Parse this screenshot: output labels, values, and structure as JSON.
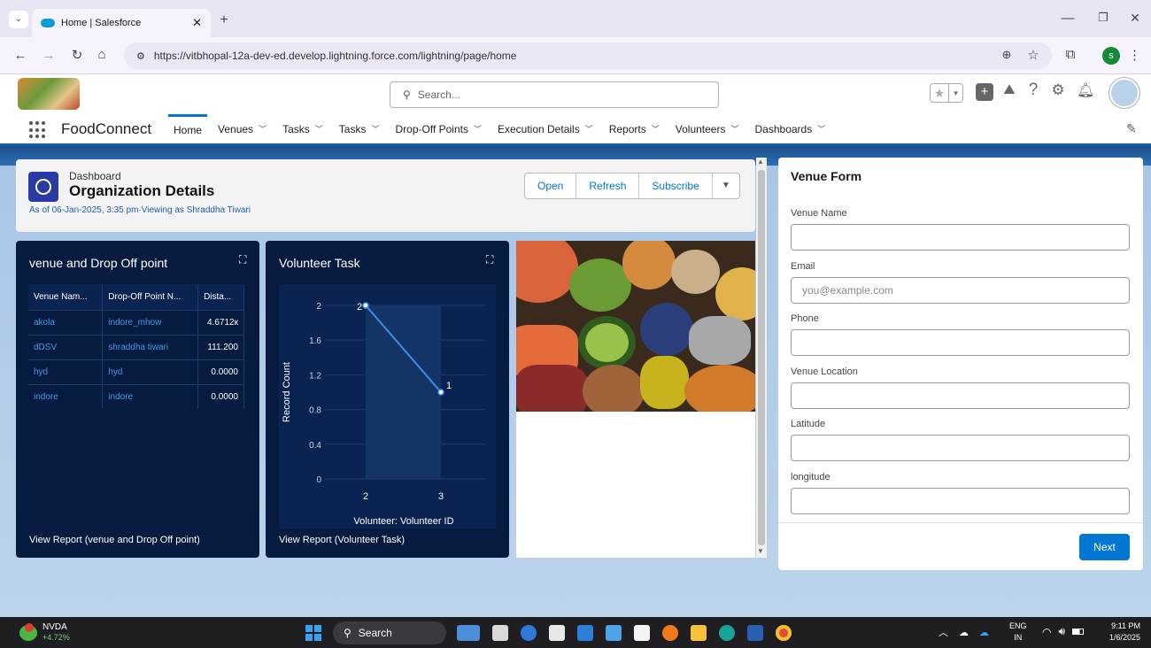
{
  "browser": {
    "tab_title": "Home | Salesforce",
    "new_tab": "+",
    "url": "https://vitbhopal-12a-dev-ed.develop.lightning.force.com/lightning/page/home",
    "profile_letter": "s"
  },
  "header": {
    "search_placeholder": "Search..."
  },
  "nav": {
    "app_name": "FoodConnect",
    "items": [
      {
        "label": "Home"
      },
      {
        "label": "Venues"
      },
      {
        "label": "Tasks"
      },
      {
        "label": "Tasks"
      },
      {
        "label": "Drop-Off Points"
      },
      {
        "label": "Execution Details"
      },
      {
        "label": "Reports"
      },
      {
        "label": "Volunteers"
      },
      {
        "label": "Dashboards"
      }
    ]
  },
  "dashboard": {
    "kicker": "Dashboard",
    "title": "Organization Details",
    "meta": "As of 06-Jan-2025, 3:35 pm·Viewing as Shraddha Tiwari",
    "open": "Open",
    "refresh": "Refresh",
    "subscribe": "Subscribe"
  },
  "venue_card": {
    "title": "venue and Drop Off point",
    "columns": [
      "Venue Nam...",
      "Drop-Off Point N...",
      "Dista..."
    ],
    "rows": [
      [
        "akola",
        "indore_mhow",
        "4.6712к"
      ],
      [
        "dDSV",
        "shraddha tiwari",
        "111.200"
      ],
      [
        "hyd",
        "hyd",
        "0.0000"
      ],
      [
        "indore",
        "indore",
        "0.0000"
      ]
    ],
    "footer": "View Report (venue and Drop Off point)"
  },
  "volunteer_card": {
    "title": "Volunteer Task",
    "footer": "View Report (Volunteer Task)"
  },
  "chart_data": {
    "type": "line",
    "title": "Volunteer Task",
    "x": [
      "2",
      "3"
    ],
    "values": [
      2,
      1
    ],
    "data_labels": [
      "2",
      "1"
    ],
    "xlabel": "Volunteer: Volunteer ID",
    "ylabel": "Record Count",
    "yticks": [
      "0",
      "0.4",
      "0.8",
      "1.2",
      "1.6",
      "2"
    ],
    "ylim": [
      0,
      2
    ],
    "grid": true,
    "line_color": "#3a8ee6"
  },
  "venue_form": {
    "title": "Venue Form",
    "fields": [
      {
        "label": "Venue Name",
        "placeholder": ""
      },
      {
        "label": "Email",
        "placeholder": "you@example.com"
      },
      {
        "label": "Phone",
        "placeholder": ""
      },
      {
        "label": "Venue Location",
        "placeholder": ""
      },
      {
        "label": "Latitude",
        "placeholder": ""
      },
      {
        "label": "longitude",
        "placeholder": ""
      }
    ],
    "next": "Next"
  },
  "taskbar": {
    "stock_name": "NVDA",
    "stock_change": "+4.72%",
    "search": "Search",
    "lang1": "ENG",
    "lang2": "IN",
    "time": "9:11 PM",
    "date": "1/6/2025"
  },
  "colors": {
    "brand_blue": "#0176d3",
    "dash_panel": "#061b3f",
    "chart_line": "#3a8ee6"
  }
}
